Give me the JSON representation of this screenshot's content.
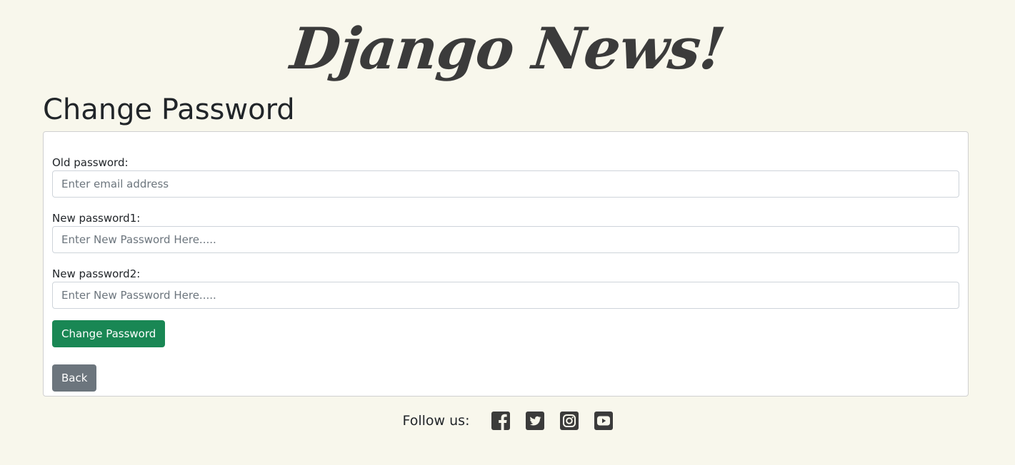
{
  "brand": {
    "title": "Django News!"
  },
  "page": {
    "title": "Change Password"
  },
  "form": {
    "fields": [
      {
        "label": "Old password:",
        "placeholder": "Enter email address",
        "value": ""
      },
      {
        "label": "New password1:",
        "placeholder": "Enter New Password Here.....",
        "value": ""
      },
      {
        "label": "New password2:",
        "placeholder": "Enter New Password Here.....",
        "value": ""
      }
    ],
    "submit_label": "Change Password",
    "back_label": "Back"
  },
  "footer": {
    "follow_label": "Follow us:",
    "social": [
      "facebook-icon",
      "twitter-icon",
      "instagram-icon",
      "youtube-icon"
    ]
  },
  "colors": {
    "background": "#f8f7ec",
    "success": "#198754",
    "secondary": "#6c757d",
    "icon": "#3b3b3b"
  }
}
